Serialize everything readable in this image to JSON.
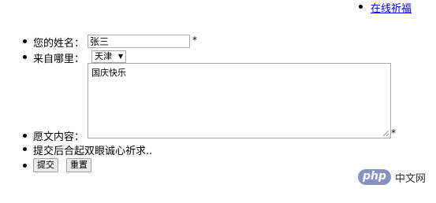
{
  "nav": {
    "link_label": "在线祈福"
  },
  "form": {
    "name_label": "您的姓名：",
    "name_value": "张三",
    "name_required": "*",
    "origin_label": "来自哪里：",
    "origin_selected": "天津",
    "content_label": "愿文内容：",
    "content_value": "国庆快乐",
    "content_required": "*",
    "note": "提交后合起双眼诚心祈求..",
    "submit_label": "提交",
    "reset_label": "重置"
  },
  "watermark": {
    "badge": "php",
    "text": "中文网",
    "color": "#8892bf"
  }
}
